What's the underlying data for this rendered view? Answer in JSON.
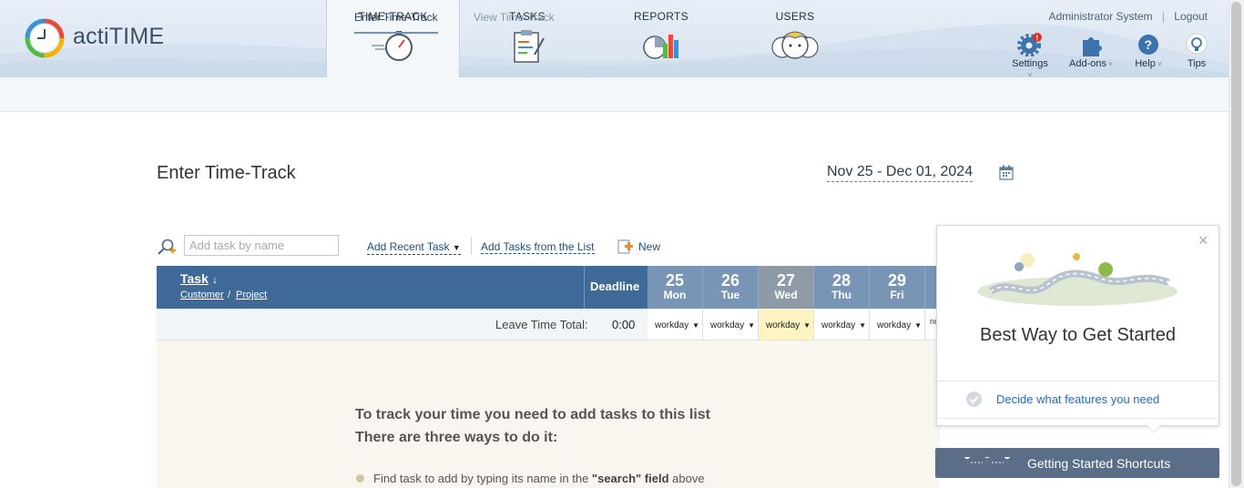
{
  "app": {
    "name": "actiTIME"
  },
  "header": {
    "tabs": [
      {
        "label": "TIME-TRACK",
        "icon": "stopwatch-icon",
        "active": true
      },
      {
        "label": "TASKS",
        "icon": "tasks-clipboard-icon",
        "active": false
      },
      {
        "label": "REPORTS",
        "icon": "reports-chart-icon",
        "active": false
      },
      {
        "label": "USERS",
        "icon": "users-icon",
        "active": false
      }
    ],
    "user_name": "Administrator System",
    "separator": "|",
    "logout_label": "Logout",
    "tools": [
      {
        "label": "Settings",
        "icon": "gear-icon",
        "badge": "!"
      },
      {
        "label": "Add-ons",
        "icon": "puzzle-icon"
      },
      {
        "label": "Help",
        "icon": "question-icon"
      },
      {
        "label": "Tips",
        "icon": "lightbulb-icon"
      }
    ]
  },
  "subnav": {
    "enter_label": "Enter Time-Track",
    "view_label": "View Time-Track"
  },
  "page": {
    "title": "Enter Time-Track",
    "date_range": "Nov 25 - Dec 01, 2024"
  },
  "toolbar": {
    "search_placeholder": "Add task by name",
    "add_recent_label": "Add Recent Task",
    "add_from_list_label": "Add Tasks from the List",
    "new_label": "New"
  },
  "table": {
    "task_header": "Task",
    "sort_arrow": "↓",
    "customer_label": "Customer",
    "slash": "/",
    "project_label": "Project",
    "deadline_header": "Deadline",
    "days": [
      {
        "num": "25",
        "name": "Mon",
        "today": false
      },
      {
        "num": "26",
        "name": "Tue",
        "today": false
      },
      {
        "num": "27",
        "name": "Wed",
        "today": true
      },
      {
        "num": "28",
        "name": "Thu",
        "today": false
      },
      {
        "num": "29",
        "name": "Fri",
        "today": false
      }
    ],
    "leave_label": "Leave Time Total:",
    "leave_total": "0:00",
    "day_types": [
      "workday",
      "workday",
      "workday",
      "workday",
      "workday"
    ],
    "clipped_day_type": "no"
  },
  "empty_state": {
    "line1": "To track your time you need to add tasks to this list",
    "line2": "There are three ways to do it:",
    "bullet1_prefix": "Find task to add by typing its name in the ",
    "bullet1_bold": "\"search\" field",
    "bullet1_suffix": " above"
  },
  "popover": {
    "close": "×",
    "title": "Best Way to Get Started",
    "item": "Decide what features you need"
  },
  "getting_started": {
    "label": "Getting Started Shortcuts"
  },
  "colors": {
    "header_blue": "#3f6a97",
    "day_blue": "#7895b6",
    "today_gray": "#8e9aa6",
    "today_yellow": "#fdf4c2",
    "link_blue": "#1f4f82",
    "button_slate": "#5a6e87"
  }
}
